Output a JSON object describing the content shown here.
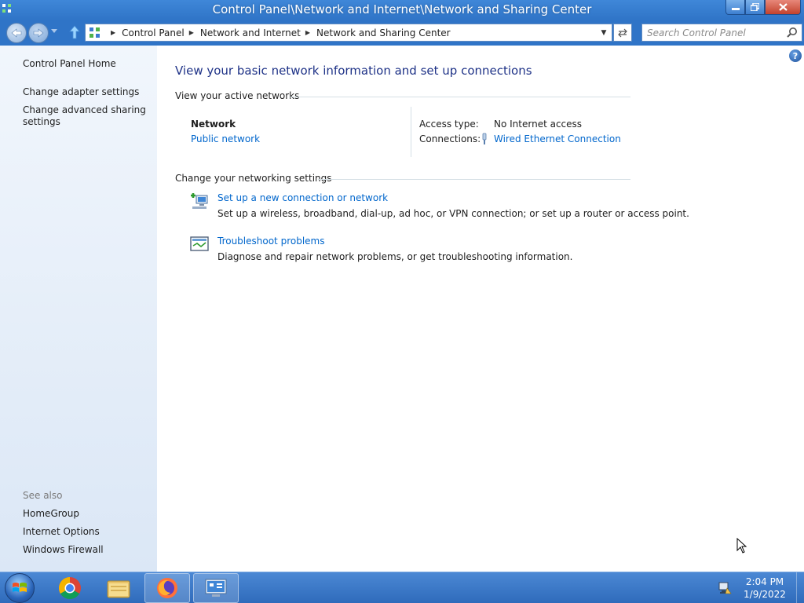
{
  "window": {
    "title": "Control Panel\\Network and Internet\\Network and Sharing Center"
  },
  "addressbar": {
    "crumbs": [
      "Control Panel",
      "Network and Internet",
      "Network and Sharing Center"
    ]
  },
  "search": {
    "placeholder": "Search Control Panel"
  },
  "sidebar": {
    "items": [
      {
        "label": "Control Panel Home"
      },
      {
        "label": "Change adapter settings"
      },
      {
        "label": "Change advanced sharing settings"
      }
    ],
    "see_also_label": "See also",
    "see_also": [
      {
        "label": "HomeGroup"
      },
      {
        "label": "Internet Options"
      },
      {
        "label": "Windows Firewall"
      }
    ]
  },
  "main": {
    "heading": "View your basic network information and set up connections",
    "active_networks_title": "View your active networks",
    "network": {
      "name": "Network",
      "category": "Public network",
      "access_type_label": "Access type:",
      "access_type_value": "No Internet access",
      "connections_label": "Connections:",
      "connection_value": "Wired Ethernet Connection"
    },
    "networking_settings_title": "Change your networking settings",
    "tasks": [
      {
        "title": "Set up a new connection or network",
        "description": "Set up a wireless, broadband, dial-up, ad hoc, or VPN connection; or set up a router or access point.",
        "icon": "new-connection-icon"
      },
      {
        "title": "Troubleshoot problems",
        "description": "Diagnose and repair network problems, or get troubleshooting information.",
        "icon": "troubleshoot-icon"
      }
    ]
  },
  "taskbar": {
    "items": [
      "start-orb",
      "chrome-icon",
      "file-explorer-icon",
      "firefox-icon",
      "network-sharing-center-icon"
    ],
    "clock_time": "2:04 PM",
    "clock_date": "1/9/2022"
  },
  "colors": {
    "accent": "#2f74c7",
    "link": "#0066cc",
    "heading": "#1e3287"
  }
}
